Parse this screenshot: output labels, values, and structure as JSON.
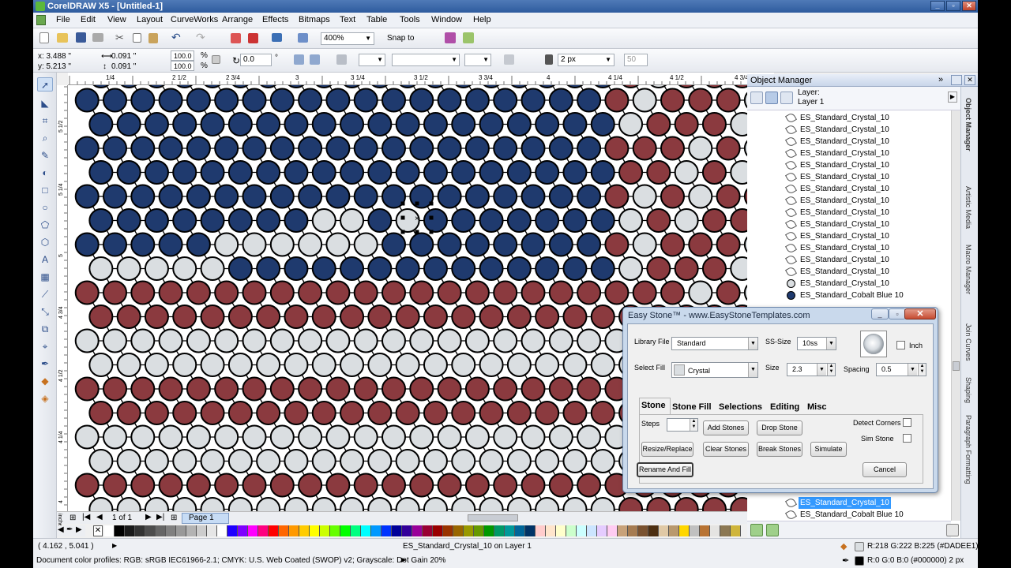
{
  "app": {
    "title": "CorelDRAW X5 - [Untitled-1]",
    "window_buttons": [
      "_",
      "▫",
      "✕"
    ]
  },
  "menu": [
    "File",
    "Edit",
    "View",
    "Layout",
    "CurveWorks",
    "Arrange",
    "Effects",
    "Bitmaps",
    "Text",
    "Table",
    "Tools",
    "Window",
    "Help"
  ],
  "toolbar": {
    "zoom": "400%",
    "snap_to": "Snap to"
  },
  "propbar": {
    "x": "x: 3.488 \"",
    "y": "y: 5.213 \"",
    "w": "0.091 \"",
    "h": "0.091 \"",
    "scale_w": "100.0",
    "scale_h": "100.0",
    "pct": "%",
    "rotation": "0.0",
    "deg": "°",
    "outline_width": "2 px",
    "transparency": "50"
  },
  "ruler": {
    "h_ticks": [
      "1/4",
      "2 1/2",
      "2 3/4",
      "3",
      "3 1/4",
      "3 1/2",
      "3 3/4",
      "4",
      "4 1/4",
      "4 1/2",
      "4 3/4"
    ],
    "unit": "inches",
    "v_ticks": [
      "5 1/2",
      "5 1/4",
      "5",
      "4 3/4",
      "4 1/2",
      "4 1/4",
      "4",
      "3 3/4"
    ],
    "v_unit": "inches"
  },
  "canvas": {
    "colors": {
      "blue": "#1f3a6e",
      "red": "#8b3a3f",
      "crystal": "#dadee1",
      "outline": "#000000",
      "line": "#000000"
    }
  },
  "page_nav": {
    "page_count": "1 of 1",
    "page_tab": "Page 1"
  },
  "palette": [
    "#ffffff",
    "#000000",
    "#1a1a1a",
    "#333333",
    "#4d4d4d",
    "#666666",
    "#808080",
    "#999999",
    "#b3b3b3",
    "#cccccc",
    "#e6e6e6",
    "#ffffff",
    "#1f00ff",
    "#7f00ff",
    "#ff00ff",
    "#ff0080",
    "#ff0000",
    "#ff6600",
    "#ff9900",
    "#ffcc00",
    "#ffff00",
    "#ccff00",
    "#66ff00",
    "#00ff00",
    "#00ff80",
    "#00ffff",
    "#0099ff",
    "#0033ff",
    "#000099",
    "#330099",
    "#990099",
    "#990033",
    "#990000",
    "#993300",
    "#996600",
    "#999900",
    "#669900",
    "#009900",
    "#009966",
    "#009999",
    "#006699",
    "#003366",
    "#ffcccc",
    "#ffe5cc",
    "#ffffcc",
    "#ccffcc",
    "#ccffff",
    "#cce5ff",
    "#e5ccff",
    "#ffccf2",
    "#c8a27a",
    "#a67c52",
    "#7a5230",
    "#4d2f12",
    "#e0c9a6",
    "#b9996e",
    "#ffd700",
    "#c0c0c0",
    "#b87333",
    "#e5e4e2",
    "#8c7853",
    "#cfb53b",
    "#fff8dc",
    "#f5deb3",
    "#deb887",
    "#d2b48c",
    "#bc8f8f"
  ],
  "status": {
    "coords": "( 4.162 , 5.041 )",
    "object_info": "ES_Standard_Crystal_10 on Layer 1",
    "fill_info": "R:218 G:222 B:225 (#DADEE1)",
    "outline_info": "R:0 G:0 B:0 (#000000)  2 px",
    "color_profiles": "Document color profiles: RGB: sRGB IEC61966-2.1; CMYK: U.S. Web Coated (SWOP) v2; Grayscale: Dot Gain 20%"
  },
  "object_manager": {
    "title": "Object Manager",
    "layer_label": "Layer:",
    "layer_name": "Layer 1",
    "items": [
      {
        "name": "ES_Standard_Crystal_10",
        "icon": "curve-icon"
      },
      {
        "name": "ES_Standard_Crystal_10",
        "icon": "curve-icon"
      },
      {
        "name": "ES_Standard_Crystal_10",
        "icon": "curve-icon"
      },
      {
        "name": "ES_Standard_Crystal_10",
        "icon": "curve-icon"
      },
      {
        "name": "ES_Standard_Crystal_10",
        "icon": "curve-icon"
      },
      {
        "name": "ES_Standard_Crystal_10",
        "icon": "curve-icon"
      },
      {
        "name": "ES_Standard_Crystal_10",
        "icon": "curve-icon"
      },
      {
        "name": "ES_Standard_Crystal_10",
        "icon": "curve-icon"
      },
      {
        "name": "ES_Standard_Crystal_10",
        "icon": "curve-icon"
      },
      {
        "name": "ES_Standard_Crystal_10",
        "icon": "curve-icon"
      },
      {
        "name": "ES_Standard_Crystal_10",
        "icon": "curve-icon"
      },
      {
        "name": "ES_Standard_Crystal_10",
        "icon": "curve-icon"
      },
      {
        "name": "ES_Standard_Crystal_10",
        "icon": "curve-icon"
      },
      {
        "name": "ES_Standard_Crystal_10",
        "icon": "curve-icon"
      },
      {
        "name": "ES_Standard_Crystal_10",
        "icon": "crystal-ellipse-icon"
      },
      {
        "name": "ES_Standard_Cobalt Blue 10",
        "icon": "blue-ellipse-icon"
      }
    ],
    "bottom_items": [
      {
        "name": "ES_Standard_Crystal_10",
        "selected": true
      },
      {
        "name": "ES_Standard_Cobalt Blue 10",
        "selected": false
      }
    ],
    "side_tabs": [
      "Object Manager",
      "Artistic Media",
      "Macro Manager",
      "Join Curves",
      "Shaping",
      "Paragraph Formatting"
    ]
  },
  "dialog": {
    "title": "Easy Stone™ - www.EasyStoneTemplates.com",
    "library_file_label": "Library File",
    "library_file": "Standard",
    "ss_size_label": "SS-Size",
    "ss_size": "10ss",
    "inch_label": "Inch",
    "select_fill_label": "Select Fill",
    "select_fill": "Crystal",
    "size_label": "Size",
    "size": "2.3",
    "spacing_label": "Spacing",
    "spacing": "0.5",
    "tabs": [
      "Stone",
      "Stone Fill",
      "Selections",
      "Editing",
      "Misc"
    ],
    "steps_label": "Steps",
    "buttons": {
      "add_stones": "Add Stones",
      "drop_stone": "Drop Stone",
      "resize_replace": "Resize/Replace",
      "clear_stones": "Clear Stones",
      "break_stones": "Break Stones",
      "simulate": "Simulate",
      "rename_and_fill": "Rename And Fill",
      "cancel": "Cancel"
    },
    "detect_corners_label": "Detect Corners",
    "sim_stone_label": "Sim Stone"
  }
}
